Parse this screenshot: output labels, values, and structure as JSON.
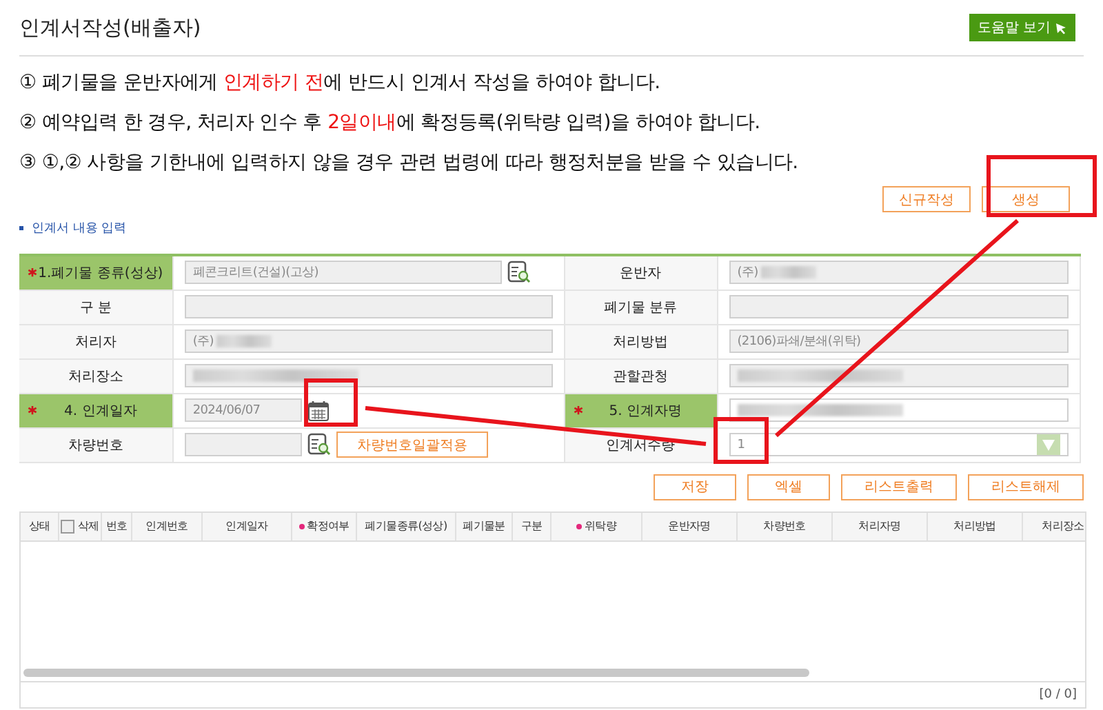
{
  "page": {
    "title": "인계서작성(배출자)",
    "help_button": "도움말 보기"
  },
  "notices": [
    {
      "parts": [
        {
          "text": "① 폐기물을 운반자에게 ",
          "highlight": false
        },
        {
          "text": "인계하기 전",
          "highlight": true
        },
        {
          "text": "에 반드시 인계서 작성을 하여야 합니다.",
          "highlight": false
        }
      ]
    },
    {
      "parts": [
        {
          "text": "② 예약입력 한 경우, 처리자 인수 후 ",
          "highlight": false
        },
        {
          "text": "2일이내",
          "highlight": true
        },
        {
          "text": "에 확정등록(위탁량 입력)을 하여야 합니다.",
          "highlight": false
        }
      ]
    },
    {
      "parts": [
        {
          "text": "③ ①,② 사항을 기한내에 입력하지 않을 경우 관련 법령에 따라 행정처분을 받을 수 있습니다.",
          "highlight": false
        }
      ]
    }
  ],
  "top_buttons": [
    "신규작성",
    "생성"
  ],
  "section_title": "인계서 내용 입력",
  "form_rows": [
    {
      "left": {
        "label": "1.폐기물 종류(성상)",
        "required": true,
        "kind": "search",
        "value": "폐콘크리트(건설)(고상)",
        "readonly": true
      },
      "right": {
        "label": "운반자",
        "required": false,
        "kind": "text",
        "value": "(주)",
        "readonly": true,
        "redacted": true
      }
    },
    {
      "left": {
        "label": "구 분",
        "required": false,
        "kind": "text",
        "readonly": true
      },
      "right": {
        "label": "폐기물 분류",
        "required": false,
        "kind": "text",
        "readonly": true
      }
    },
    {
      "left": {
        "label": "처리자",
        "required": false,
        "kind": "text",
        "value": "(주)",
        "readonly": true,
        "redacted": true
      },
      "right": {
        "label": "처리방법",
        "required": false,
        "kind": "text",
        "value": "(2106)파쇄/분쇄(위탁)",
        "readonly": true
      }
    },
    {
      "left": {
        "label": "처리장소",
        "required": false,
        "kind": "text",
        "readonly": true,
        "redacted": true
      },
      "right": {
        "label": "관할관청",
        "required": false,
        "kind": "text",
        "readonly": true,
        "redacted": true
      }
    },
    {
      "left": {
        "label": "4. 인계일자",
        "required": true,
        "kind": "date",
        "value": "2024/06/07",
        "readonly": true
      },
      "right": {
        "label": "5. 인계자명",
        "required": true,
        "kind": "text",
        "readonly": false,
        "redacted": true
      }
    },
    {
      "left": {
        "label": "차량번호",
        "required": false,
        "kind": "vehicle",
        "readonly": true,
        "button": "차량번호일괄적용"
      },
      "right": {
        "label": "인계서수량",
        "required": false,
        "kind": "select",
        "value": "1",
        "readonly": false
      }
    }
  ],
  "action_buttons": [
    "저장",
    "엑셀",
    "리스트출력",
    "리스트해제"
  ],
  "grid": {
    "columns": [
      {
        "label": "상태",
        "kind": "plain"
      },
      {
        "label": "삭제",
        "kind": "checkbox",
        "checked": false
      },
      {
        "label": "번호",
        "kind": "plain"
      },
      {
        "label": "인계번호",
        "kind": "plain"
      },
      {
        "label": "인계일자",
        "kind": "plain"
      },
      {
        "label": "확정여부",
        "kind": "required"
      },
      {
        "label": "폐기물종류(성상)",
        "kind": "plain"
      },
      {
        "label": "폐기물분",
        "kind": "plain"
      },
      {
        "label": "구분",
        "kind": "plain"
      },
      {
        "label": "위탁량",
        "kind": "required"
      },
      {
        "label": "운반자명",
        "kind": "plain"
      },
      {
        "label": "차량번호",
        "kind": "plain"
      },
      {
        "label": "처리자명",
        "kind": "plain"
      },
      {
        "label": "처리방법",
        "kind": "plain"
      },
      {
        "label": "처리장소",
        "kind": "plain"
      }
    ],
    "footer": "[0 / 0]"
  }
}
